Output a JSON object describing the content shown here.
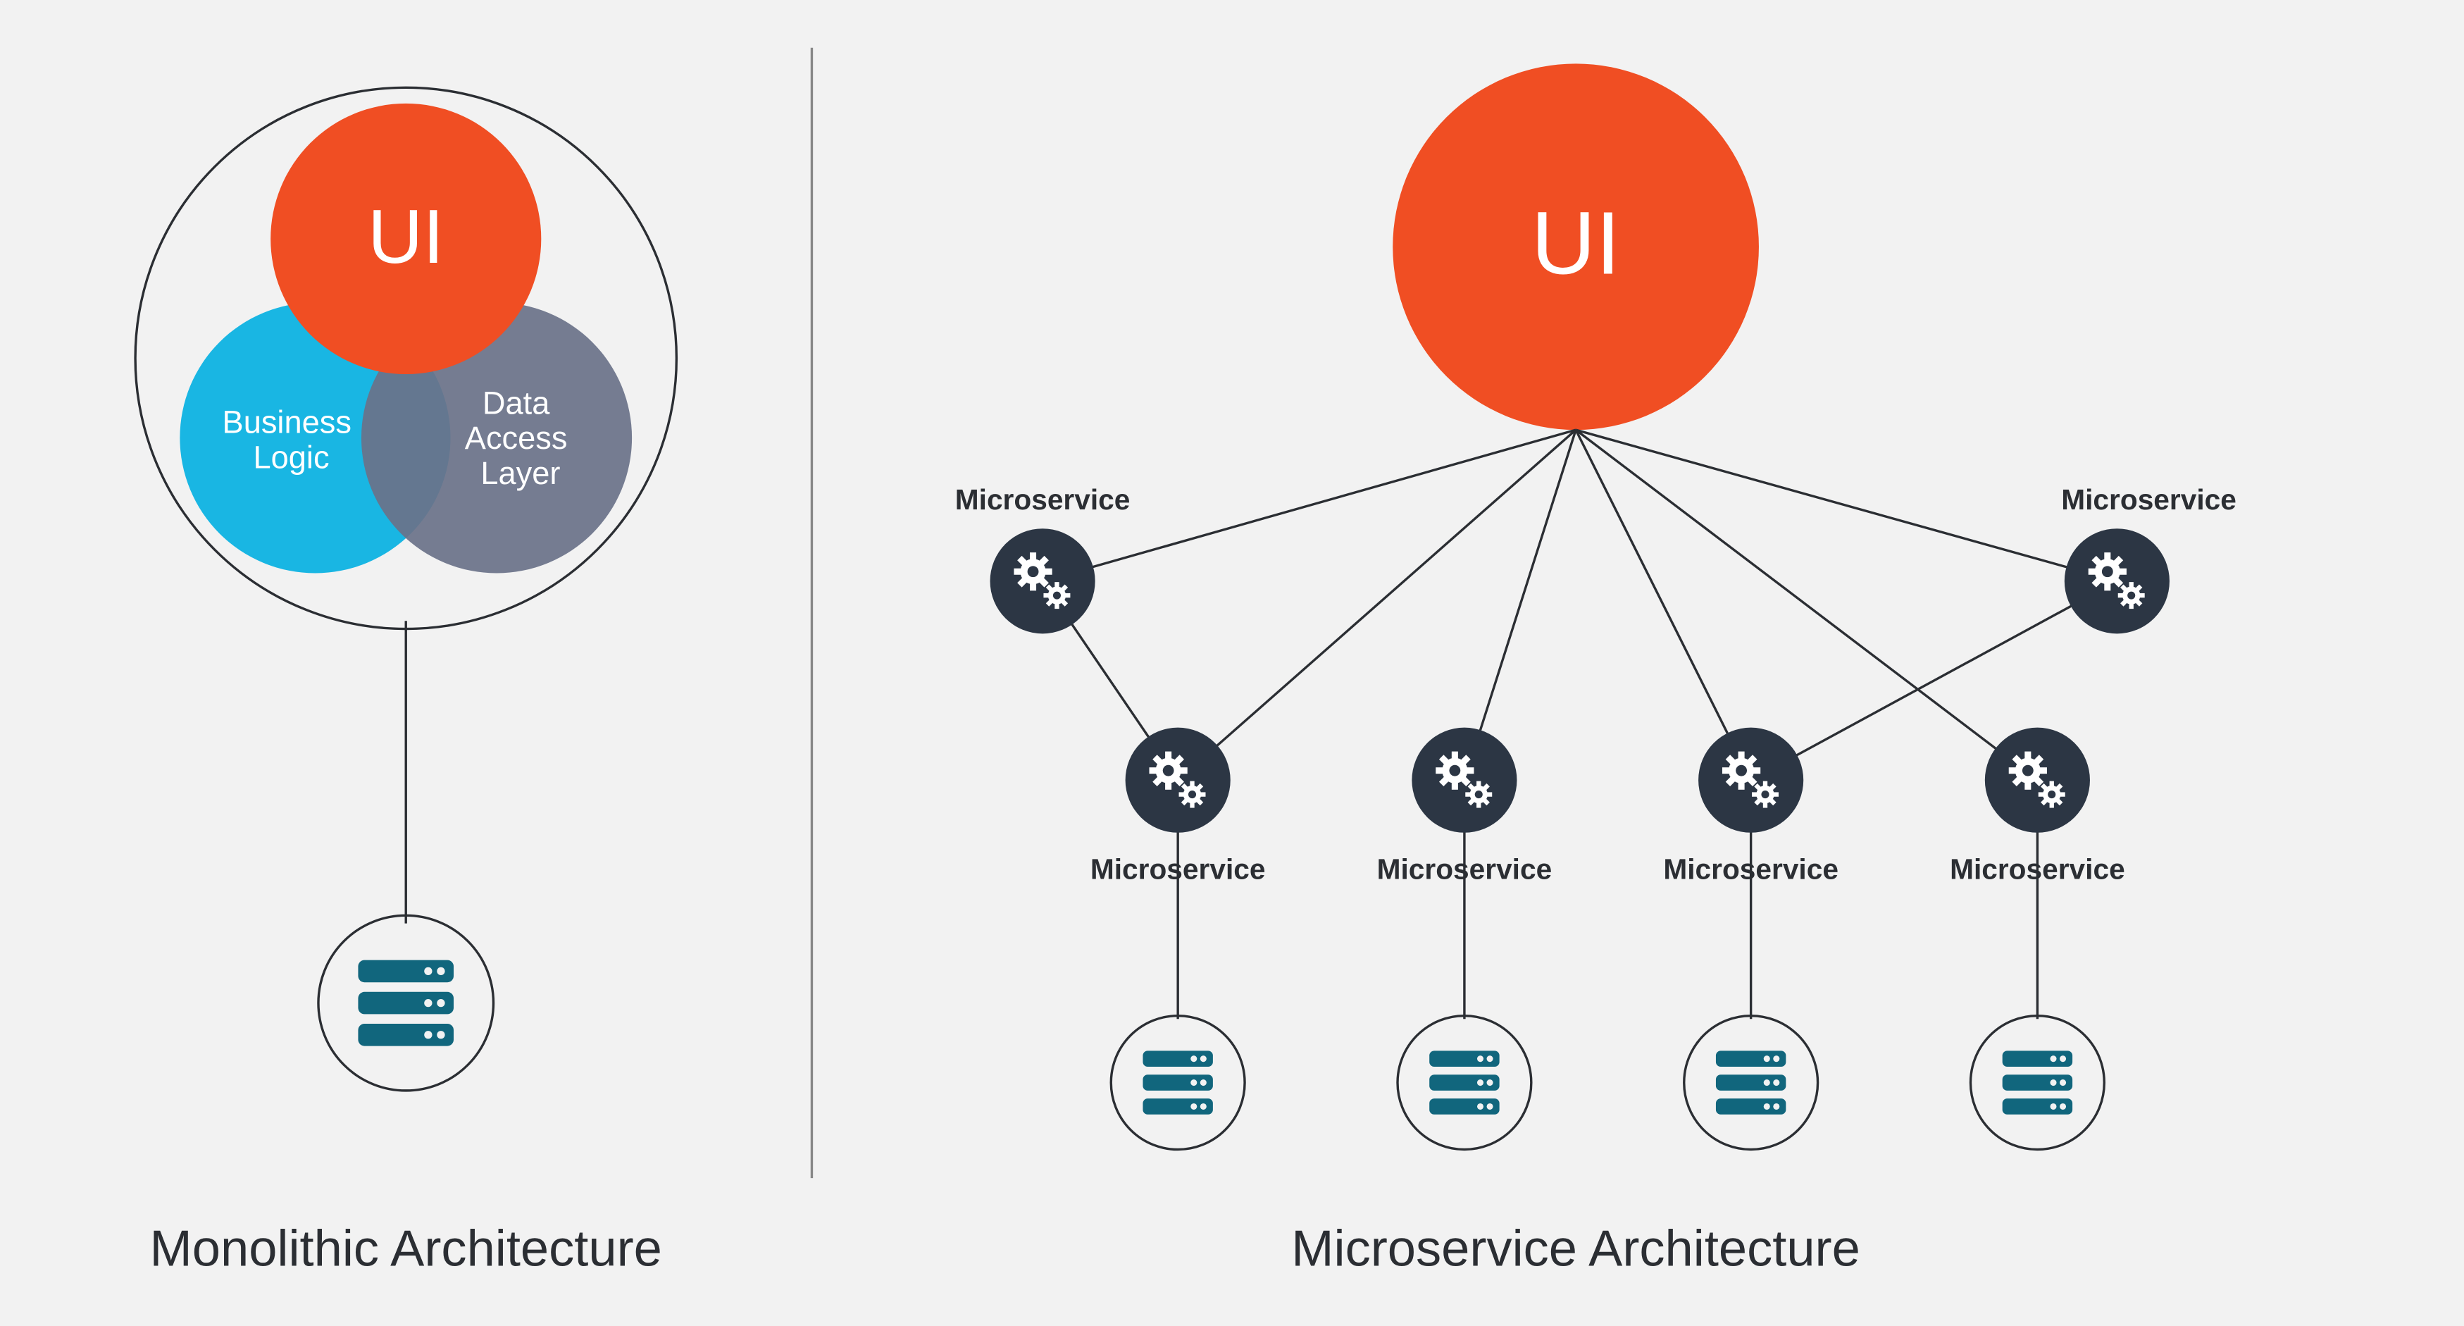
{
  "left": {
    "title": "Monolithic Architecture",
    "ui_label": "UI",
    "business_logic_label": "Business Logic",
    "data_access_label": "Data Access Layer"
  },
  "right": {
    "title": "Microservice Architecture",
    "ui_label": "UI",
    "microservice_label": "Microservice"
  },
  "colors": {
    "orange": "#f04e23",
    "cyan": "#19b6e3",
    "slate": "#6a7289",
    "dark": "#2c3644",
    "teal": "#11667d",
    "outline": "#2b2e33",
    "divider": "#9a9a9a"
  }
}
